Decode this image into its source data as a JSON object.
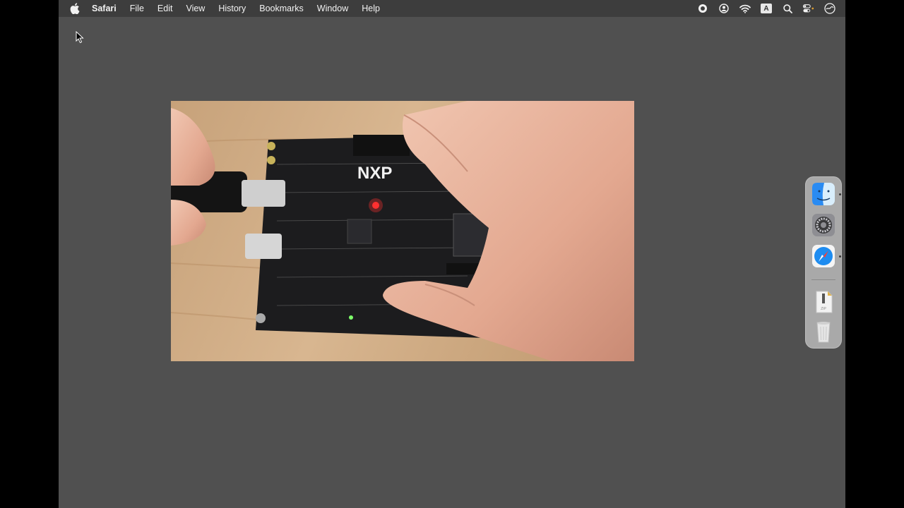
{
  "menubar": {
    "app_name": "Safari",
    "menus": [
      "File",
      "Edit",
      "View",
      "History",
      "Bookmarks",
      "Window",
      "Help"
    ],
    "status_icons": [
      "screen-record-icon",
      "user-account-icon",
      "wifi-icon",
      "input-source-icon",
      "spotlight-search-icon",
      "control-center-icon",
      "siri-icon"
    ],
    "input_source_label": "A"
  },
  "video": {
    "subject": "hand holding NXP development board",
    "board_brand": "NXP"
  },
  "dock": {
    "items": [
      "finder-icon",
      "system-settings-icon",
      "safari-icon",
      "downloads-icon",
      "trash-icon"
    ]
  }
}
